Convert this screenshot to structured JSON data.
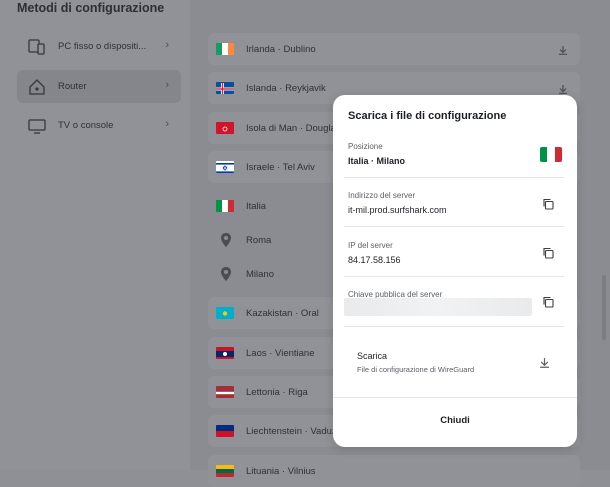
{
  "left_panel": {
    "title": "Metodi di configurazione",
    "methods": [
      {
        "label": "PC fisso o dispositi...",
        "icon": "devices-icon"
      },
      {
        "label": "Router",
        "icon": "router-icon"
      },
      {
        "label": "TV o console",
        "icon": "tv-icon"
      }
    ]
  },
  "locations": [
    {
      "name": "Irlanda · Dublino",
      "flag": "ie"
    },
    {
      "name": "Islanda · Reykjavik",
      "flag": "is"
    },
    {
      "name": "Isola di Man · Douglas",
      "flag": "im"
    },
    {
      "name": "Israele · Tel Aviv",
      "flag": "il"
    },
    {
      "name": "Italia",
      "flag": "it"
    },
    {
      "name": "Roma",
      "flag": "pin"
    },
    {
      "name": "Milano",
      "flag": "pin"
    },
    {
      "name": "Kazakistan · Oral",
      "flag": "kz"
    },
    {
      "name": "Laos · Vientiane",
      "flag": "la"
    },
    {
      "name": "Lettonia · Riga",
      "flag": "lv"
    },
    {
      "name": "Liechtenstein · Vaduz",
      "flag": "li"
    },
    {
      "name": "Lituania · Vilnius",
      "flag": "lt"
    }
  ],
  "modal": {
    "title": "Scarica i file di configurazione",
    "position_label": "Posizione",
    "position_value": "Italia · Milano",
    "server_address_label": "Indirizzo del server",
    "server_address_value": "it-mil.prod.surfshark.com",
    "server_ip_label": "IP del server",
    "server_ip_value": "84.17.58.156",
    "public_key_label": "Chiave pubblica del server",
    "download_title": "Scarica",
    "download_subtitle": "File di configurazione di WireGuard",
    "close_label": "Chiudi"
  },
  "colors": {
    "overlay_bg": "#8e9096",
    "modal_bg": "#ffffff",
    "text_dark": "#1c1f26",
    "italy_green": "#009246",
    "italy_red": "#ce2b37"
  }
}
